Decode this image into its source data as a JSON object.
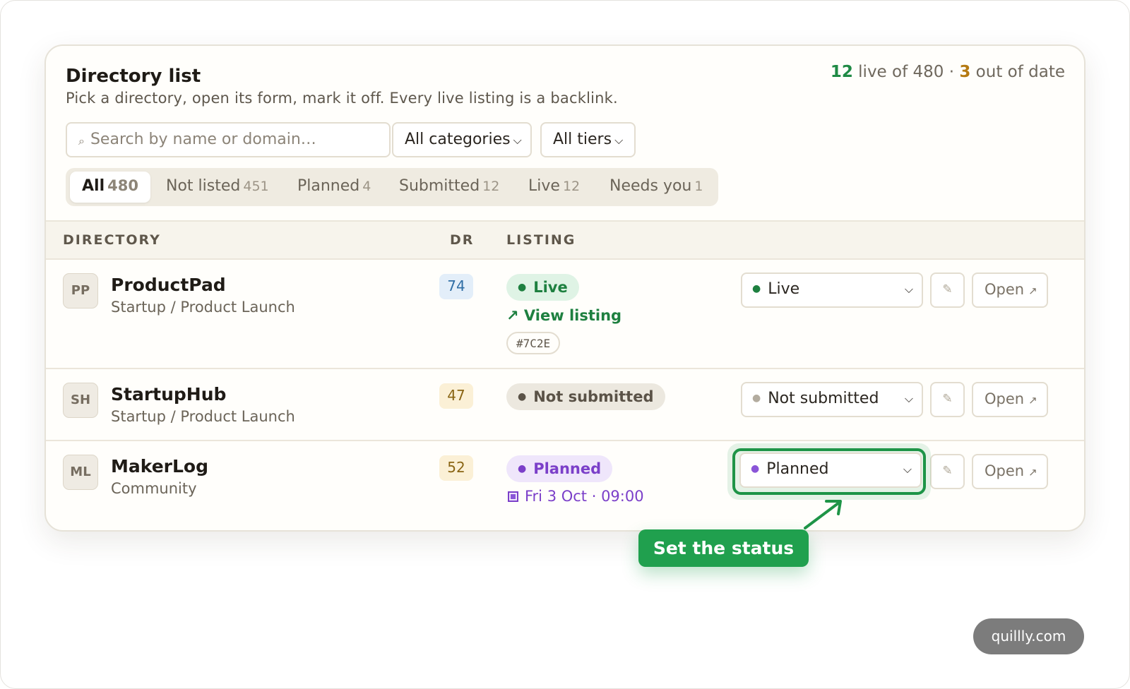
{
  "header": {
    "title": "Directory list",
    "subtitle": "Pick a directory, open its form, mark it off. Every live listing is a backlink.",
    "stats": {
      "live_count": "12",
      "live_text": " live of 480 · ",
      "out_count": "3",
      "out_text": " out of date"
    }
  },
  "filters": {
    "search_placeholder": "Search by name or domain…",
    "category_label": "All categories",
    "tier_label": "All tiers"
  },
  "tabs": [
    {
      "label": "All",
      "count": "480"
    },
    {
      "label": "Not listed",
      "count": "451"
    },
    {
      "label": "Planned",
      "count": "4"
    },
    {
      "label": "Submitted",
      "count": "12"
    },
    {
      "label": "Live",
      "count": "12"
    },
    {
      "label": "Needs you",
      "count": "1"
    }
  ],
  "table": {
    "columns": {
      "directory": "DIRECTORY",
      "dr": "DR",
      "listing": "LISTING"
    },
    "rows": [
      {
        "initials": "PP",
        "name": "ProductPad",
        "category": "Startup / Product Launch",
        "dr": "74",
        "status_pill": "Live",
        "link_text": "View listing",
        "tag": "#7C2E",
        "select_value": "Live",
        "open_label": "Open"
      },
      {
        "initials": "SH",
        "name": "StartupHub",
        "category": "Startup / Product Launch",
        "dr": "47",
        "status_pill": "Not submitted",
        "select_value": "Not submitted",
        "open_label": "Open"
      },
      {
        "initials": "ML",
        "name": "MakerLog",
        "category": "Community",
        "dr": "52",
        "status_pill": "Planned",
        "date": "Fri 3 Oct · 09:00",
        "select_value": "Planned",
        "open_label": "Open"
      }
    ]
  },
  "callout": {
    "text": "Set the status"
  },
  "watermark": "quillly.com",
  "colors": {
    "accent_green": "#1e9447",
    "live_green": "#1e8040",
    "planned_purple": "#7b3fc9",
    "amber": "#b57a12",
    "card_border": "#e6e2d8"
  },
  "icons": {
    "search": "search-icon",
    "chevron": "chevron-down-icon",
    "edit": "pencil-icon",
    "external": "external-link-icon",
    "calendar": "calendar-icon"
  }
}
